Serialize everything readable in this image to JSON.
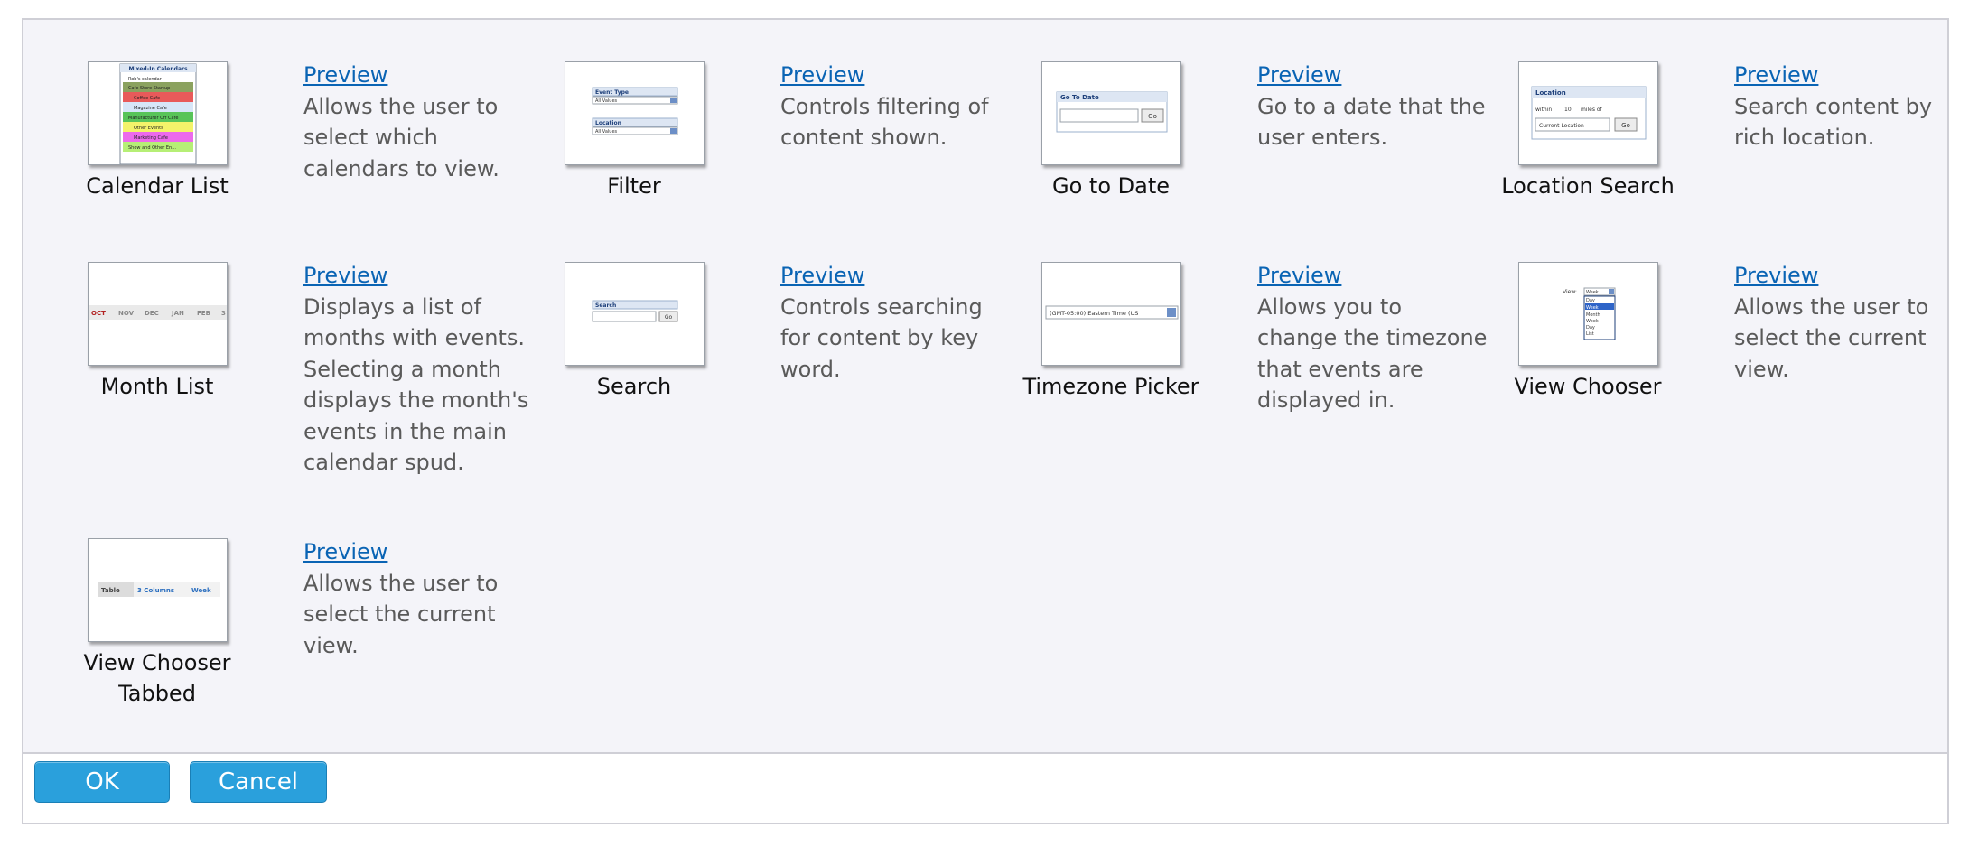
{
  "widgets": [
    {
      "name": "Calendar List",
      "link": "Preview",
      "description": "Allows the user to select which calendars to view."
    },
    {
      "name": "Filter",
      "link": "Preview",
      "description": "Controls filtering of content shown."
    },
    {
      "name": "Go to Date",
      "link": "Preview",
      "description": "Go to a date that the user enters."
    },
    {
      "name": "Location Search",
      "link": "Preview",
      "description": "Search content by rich location."
    },
    {
      "name": "Month List",
      "link": "Preview",
      "description": "Displays a list of months with events. Selecting a month displays the month's events in the main calendar spud."
    },
    {
      "name": "Search",
      "link": "Preview",
      "description": "Controls searching for content by key word."
    },
    {
      "name": "Timezone Picker",
      "link": "Preview",
      "description": "Allows you to change the timezone that events are displayed in."
    },
    {
      "name": "View Chooser",
      "link": "Preview",
      "description": "Allows the user to select the current view."
    },
    {
      "name": "View Chooser Tabbed",
      "link": "Preview",
      "description": "Allows the user to select the current view."
    }
  ],
  "thumbs": {
    "calendar_list": {
      "title": "Mixed-In Calendars",
      "rows": [
        "Rob's calendar",
        "Cafe Store Startup",
        "Coffee Cafe",
        "Magazine Cafe",
        "Manufacturer Off Cafe",
        "Other Events",
        "Marketing Cafe",
        "Show and Other En..."
      ]
    },
    "filter": {
      "label1": "Event Type",
      "value1": "All Values",
      "label2": "Location",
      "value2": "All Values"
    },
    "goto": {
      "title": "Go To Date",
      "button": "Go"
    },
    "location": {
      "title": "Location",
      "within": "within",
      "miles": "10",
      "miles_of": "miles of",
      "current": "Current Location",
      "button": "Go"
    },
    "month_list": {
      "months": [
        "OCT",
        "NOV",
        "DEC",
        "JAN",
        "FEB",
        "3"
      ]
    },
    "search": {
      "title": "Search",
      "button": "Go"
    },
    "timezone": {
      "value": "(GMT-05:00) Eastern Time (US"
    },
    "view_chooser": {
      "label": "View:",
      "selected": "Week",
      "options": [
        "Day",
        "Week",
        "Month",
        "Week",
        "Day",
        "List"
      ]
    },
    "tabbed": {
      "tabs": [
        "Table",
        "3 Columns",
        "Week"
      ]
    }
  },
  "buttons": {
    "ok": "OK",
    "cancel": "Cancel"
  },
  "colors": {
    "accent": "#2aa0dc",
    "link": "#0a64b4",
    "panel": "#f4f4f9"
  }
}
